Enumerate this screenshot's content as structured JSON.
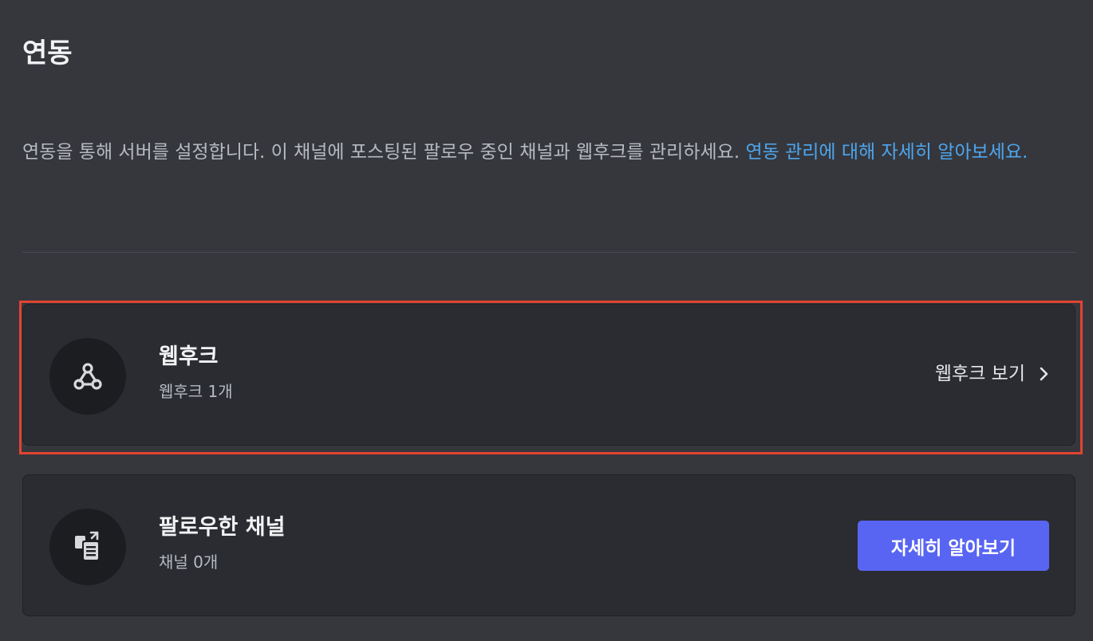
{
  "header": {
    "title": "연동"
  },
  "description": {
    "text": "연동을 통해 서버를 설정합니다. 이 채널에 포스팅된 팔로우 중인 채널과 웹후크를 관리하세요. ",
    "link_text": "연동 관리에 대해 자세히 알아보세요."
  },
  "webhooks_card": {
    "icon": "webhook-icon",
    "title": "웹후크",
    "subtitle": "웹후크 1개",
    "action_label": "웹후크 보기"
  },
  "followed_card": {
    "icon": "followed-channels-icon",
    "title": "팔로우한 채널",
    "subtitle": "채널 0개",
    "button_label": "자세히 알아보기"
  },
  "colors": {
    "background": "#36373d",
    "card": "#2b2c31",
    "link": "#4da6ee",
    "primary_button": "#5865f2",
    "highlight": "#e2432f"
  }
}
